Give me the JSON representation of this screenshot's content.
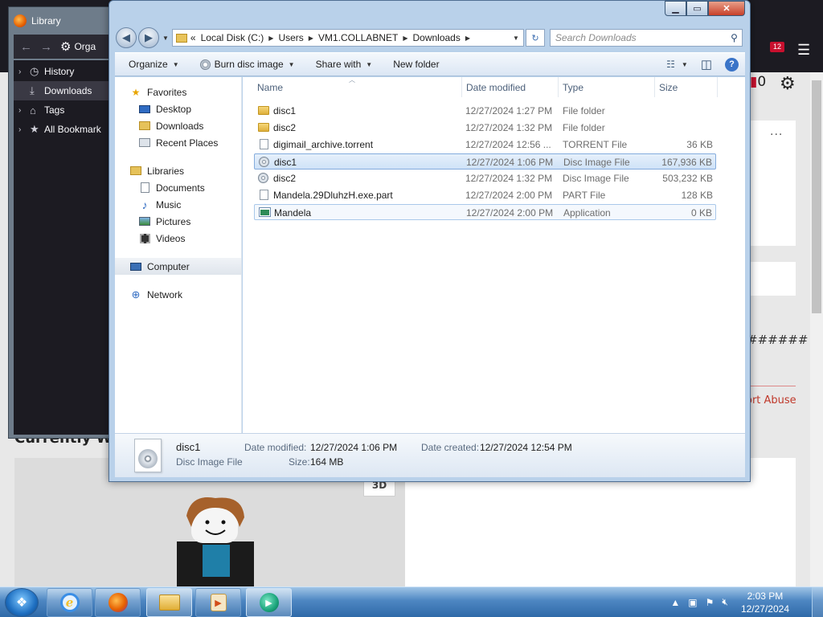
{
  "library": {
    "title": "Library",
    "organize_label": "Orga",
    "items": [
      {
        "label": "History",
        "icon": "clock-icon"
      },
      {
        "label": "Downloads",
        "icon": "download-icon",
        "selected": true
      },
      {
        "label": "Tags",
        "icon": "tag-icon"
      },
      {
        "label": "All Bookmark",
        "icon": "star-icon"
      }
    ]
  },
  "background": {
    "hashes": "######",
    "report": "ort Abuse",
    "heading": "Currently W",
    "tag3d": "3D",
    "notif_count": "0",
    "badge": "12",
    "dots": "···"
  },
  "explorer": {
    "address": {
      "prefix": "«",
      "segments": [
        "Local Disk (C:)",
        "Users",
        "VM1.COLLABNET",
        "Downloads"
      ]
    },
    "search_placeholder": "Search Downloads",
    "commands": {
      "organize": "Organize",
      "burn": "Burn disc image",
      "share": "Share with",
      "new_folder": "New folder"
    },
    "nav": {
      "favorites": "Favorites",
      "desktop": "Desktop",
      "downloads": "Downloads",
      "recent": "Recent Places",
      "libraries": "Libraries",
      "documents": "Documents",
      "music": "Music",
      "pictures": "Pictures",
      "videos": "Videos",
      "computer": "Computer",
      "network": "Network"
    },
    "columns": {
      "name": "Name",
      "date": "Date modified",
      "type": "Type",
      "size": "Size"
    },
    "files": [
      {
        "name": "disc1",
        "date": "12/27/2024 1:27 PM",
        "type": "File folder",
        "size": "",
        "icon": "folder-icon"
      },
      {
        "name": "disc2",
        "date": "12/27/2024 1:32 PM",
        "type": "File folder",
        "size": "",
        "icon": "folder-icon"
      },
      {
        "name": "digimail_archive.torrent",
        "date": "12/27/2024 12:56 ...",
        "type": "TORRENT File",
        "size": "36 KB",
        "icon": "document-icon"
      },
      {
        "name": "disc1",
        "date": "12/27/2024 1:06 PM",
        "type": "Disc Image File",
        "size": "167,936 KB",
        "icon": "disc-image-icon",
        "selected": true
      },
      {
        "name": "disc2",
        "date": "12/27/2024 1:32 PM",
        "type": "Disc Image File",
        "size": "503,232 KB",
        "icon": "disc-image-icon"
      },
      {
        "name": "Mandela.29DluhzH.exe.part",
        "date": "12/27/2024 2:00 PM",
        "type": "PART File",
        "size": "128 KB",
        "icon": "document-icon"
      },
      {
        "name": "Mandela",
        "date": "12/27/2024 2:00 PM",
        "type": "Application",
        "size": "0 KB",
        "icon": "application-icon",
        "hover": true
      }
    ],
    "details": {
      "name": "disc1",
      "type": "Disc Image File",
      "date_modified_label": "Date modified:",
      "date_modified": "12/27/2024 1:06 PM",
      "date_created_label": "Date created:",
      "date_created": "12/27/2024 12:54 PM",
      "size_label": "Size:",
      "size": "164 MB"
    }
  },
  "taskbar": {
    "time": "2:03 PM",
    "date": "12/27/2024"
  }
}
